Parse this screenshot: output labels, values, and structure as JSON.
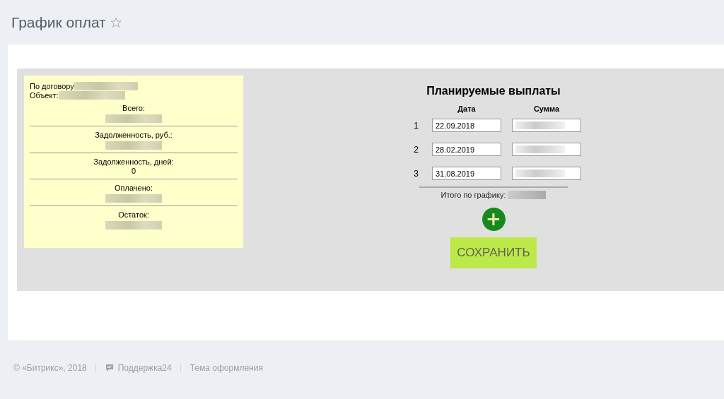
{
  "page_title": "График оплат",
  "favorite": false,
  "summary": {
    "contract_label": "По договору",
    "object_label": "Объект:",
    "sections": [
      {
        "label": "Всего:"
      },
      {
        "label": "Задолженность, руб.:"
      },
      {
        "label": "Задолженность, дней:",
        "value": "0"
      },
      {
        "label": "Оплачено:"
      },
      {
        "label": "Остаток:"
      }
    ]
  },
  "schedule": {
    "title": "Планируемые выплаты",
    "columns": [
      "Дата",
      "Сумма"
    ],
    "rows": [
      {
        "number": "1",
        "date": "22.09.2018"
      },
      {
        "number": "2",
        "date": "28.02.2019"
      },
      {
        "number": "3",
        "date": "31.08.2019"
      }
    ],
    "total_label": "Итого по графику:",
    "add_button": "+",
    "save_button": "СОХРАНИТЬ"
  },
  "footer": {
    "copyright": "© «Битрикс», 2018",
    "support": "Поддержка24",
    "theme": "Тема оформления"
  }
}
